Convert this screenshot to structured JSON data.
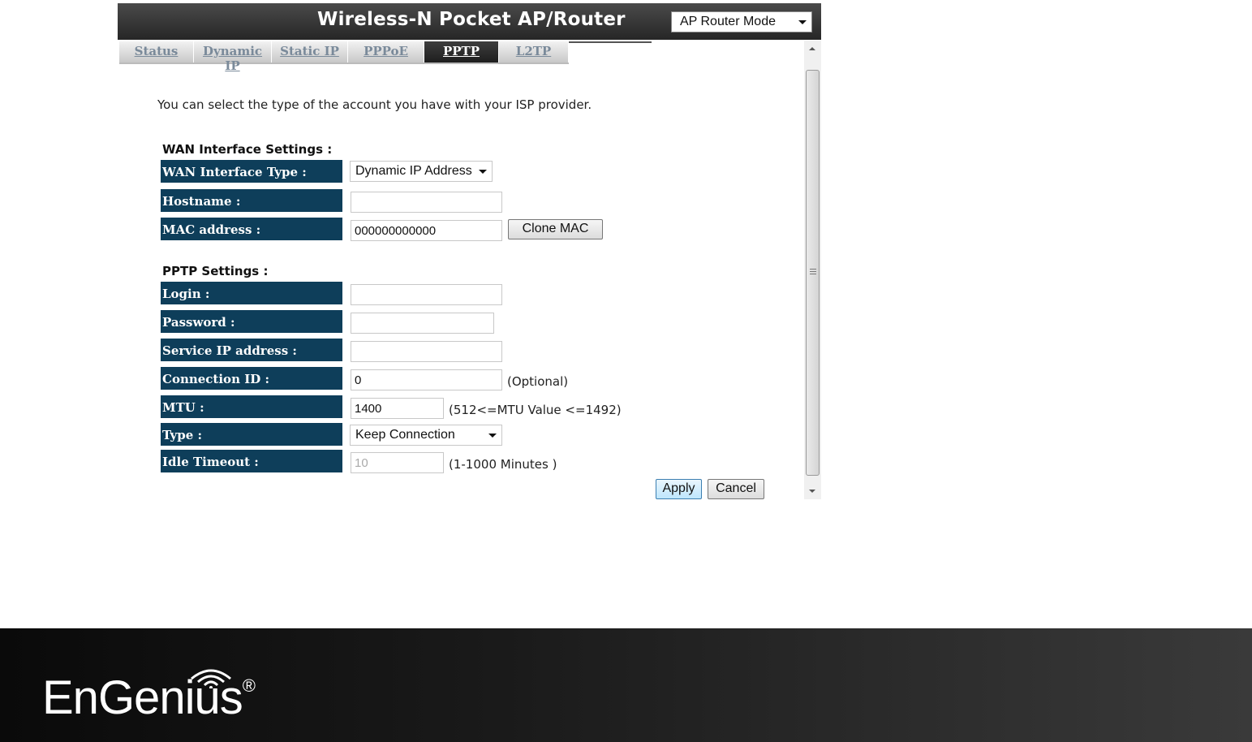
{
  "header": {
    "title": "Wireless-N Pocket AP/Router",
    "mode": "AP Router Mode"
  },
  "tabs": [
    {
      "label": "Status",
      "active": false
    },
    {
      "label": "Dynamic IP",
      "active": false
    },
    {
      "label": "Static IP",
      "active": false
    },
    {
      "label": "PPPoE",
      "active": false
    },
    {
      "label": "PPTP",
      "active": true
    },
    {
      "label": "L2TP",
      "active": false
    }
  ],
  "intro": "You can select the type of the account you have with your ISP provider.",
  "wan": {
    "section_title": "WAN Interface Settings :",
    "type_label": "WAN Interface Type :",
    "type_value": "Dynamic IP Address",
    "hostname_label": "Hostname :",
    "hostname_value": "",
    "mac_label": "MAC address :",
    "mac_value": "000000000000",
    "clone_mac_label": "Clone MAC"
  },
  "pptp": {
    "section_title": "PPTP Settings :",
    "login_label": "Login :",
    "login_value": "",
    "password_label": "Password :",
    "password_value": "",
    "service_ip_label": "Service IP address :",
    "service_ip_value": "",
    "connection_id_label": "Connection ID :",
    "connection_id_value": "0",
    "connection_id_hint": "(Optional)",
    "mtu_label": "MTU :",
    "mtu_value": "1400",
    "mtu_hint": "(512<=MTU Value <=1492)",
    "type_label": "Type :",
    "type_value": "Keep Connection",
    "idle_label": "Idle Timeout :",
    "idle_value": "10",
    "idle_hint": "(1-1000 Minutes )"
  },
  "actions": {
    "apply": "Apply",
    "cancel": "Cancel"
  },
  "footer": {
    "brand": "EnGenius",
    "registered": "®"
  },
  "colors": {
    "label_bg": "#0e3e5a",
    "header_bg": "#262626"
  }
}
